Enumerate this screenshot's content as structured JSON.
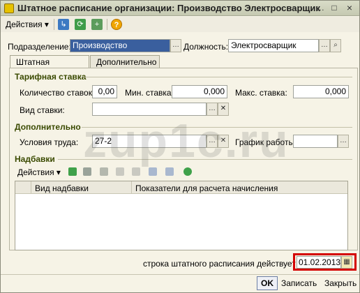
{
  "window": {
    "title": "Штатное расписание организации: Производство Электросварщик",
    "controls": [
      "…",
      "□",
      "×"
    ]
  },
  "toolbar": {
    "actions_label": "Действия ▾",
    "help_label": "?"
  },
  "header": {
    "department_label": "Подразделение:",
    "department_value": "Производство",
    "position_label": "Должность:",
    "position_value": "Электросварщик"
  },
  "tabs": [
    {
      "label": "Штатная единица"
    },
    {
      "label": "Дополнительно"
    }
  ],
  "tariff": {
    "title": "Тарифная ставка",
    "count_label": "Количество ставок:",
    "count_value": "0,00",
    "min_label": "Мин. ставка:",
    "min_value": "0,000",
    "max_label": "Макс. ставка:",
    "max_value": "0,000",
    "rate_type_label": "Вид ставки:",
    "rate_type_value": ""
  },
  "additional": {
    "title": "Дополнительно",
    "conditions_label": "Условия труда:",
    "conditions_value": "27-2",
    "schedule_label": "График работы:",
    "schedule_value": ""
  },
  "allowances": {
    "title": "Надбавки",
    "actions_label": "Действия ▾",
    "columns": [
      "Вид надбавки",
      "Показатели для расчета начисления"
    ]
  },
  "watermark": "zup1c.ru",
  "footer": {
    "effective_label": "строка штатного расписания действует с:",
    "effective_date": "01.02.2013",
    "ok_label": "OK",
    "save_label": "Записать",
    "close_label": "Закрыть"
  },
  "colors": {
    "selection": "#3a5f9e",
    "section_title": "#3a4a00",
    "highlight_box": "#d40000"
  }
}
